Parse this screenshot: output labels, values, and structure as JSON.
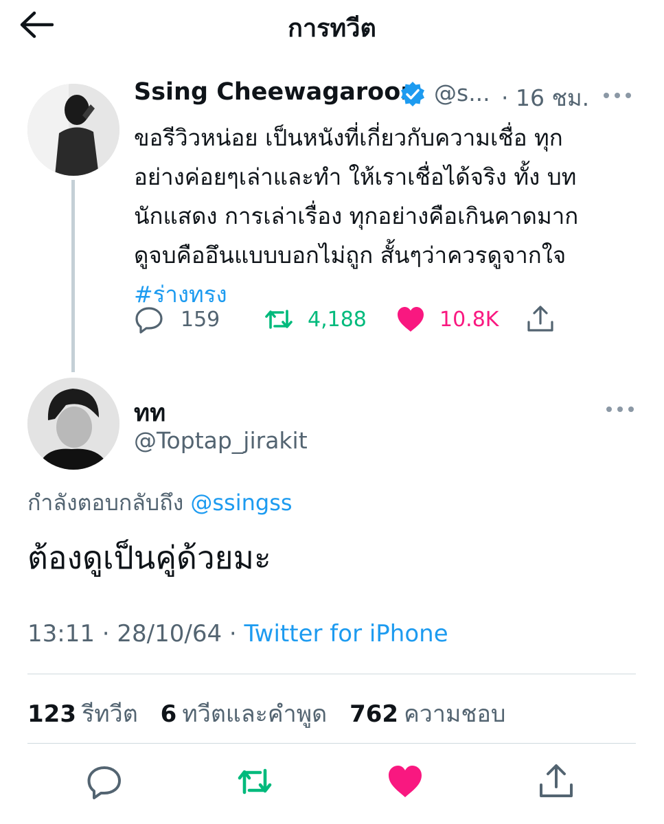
{
  "header": {
    "title": "การทวีต"
  },
  "original_tweet": {
    "author_name": "Ssing Cheewagaroon",
    "handle": "@s...",
    "time": "· 16 ชม.",
    "text_lines": [
      "ขอรีวิวหน่อย เป็นหนังที่เกี่ยวกับความเชื่อ ทุก",
      "อย่างค่อยๆเล่าและทำ ให้เราเชื่อได้จริง  ทั้ง บท",
      "นักแสดง การเล่าเรื่อง ทุกอย่างคือเกินคาดมาก",
      "ดูจบคืออึนแบบบอกไม่ถูก  สั้นๆว่าควรดูจากใจ"
    ],
    "hashtag": "#ร่างทรง",
    "replies": "159",
    "retweets": "4,188",
    "likes": "10.8K",
    "colors": {
      "retweet": "#00ba7c",
      "like": "#f91880",
      "verified": "#1d9bf0"
    }
  },
  "reply_tweet": {
    "author_name": "ทท",
    "handle": "@Toptap_jirakit",
    "replying_to_label": "กำลังตอบกลับถึง",
    "replying_to_handle": "@ssingss",
    "text": "ต้องดูเป็นคู่ด้วยมะ",
    "timestamp": "13:11 · 28/10/64 · ",
    "source": "Twitter for iPhone",
    "stats": {
      "retweets_count": "123",
      "retweets_label": "รีทวีต",
      "quotes_count": "6",
      "quotes_label": "ทวีตและคำพูด",
      "likes_count": "762",
      "likes_label": "ความชอบ"
    }
  },
  "icons": [
    "back-arrow-icon",
    "verified-badge-icon",
    "more-icon",
    "reply-icon",
    "retweet-icon",
    "like-icon",
    "share-icon"
  ]
}
